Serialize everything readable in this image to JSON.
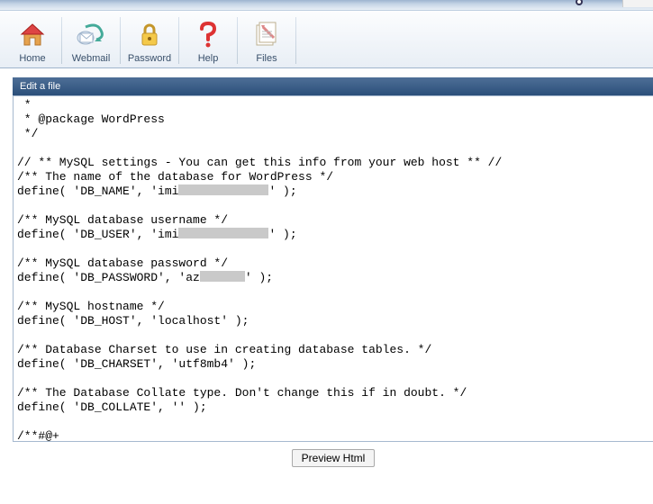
{
  "toolbar": {
    "items": [
      {
        "id": "home",
        "label": "Home",
        "icon": "home-icon"
      },
      {
        "id": "webmail",
        "label": "Webmail",
        "icon": "mail-icon"
      },
      {
        "id": "password",
        "label": "Password",
        "icon": "lock-icon"
      },
      {
        "id": "help",
        "label": "Help",
        "icon": "help-icon"
      },
      {
        "id": "files",
        "label": "Files",
        "icon": "files-icon"
      }
    ]
  },
  "panel": {
    "title": "Edit a file"
  },
  "editor": {
    "lines": [
      " *",
      " * @package WordPress",
      " */",
      "",
      "// ** MySQL settings - You can get this info from your web host ** //",
      "/** The name of the database for WordPress */",
      "define( 'DB_NAME', 'imi",
      "' );",
      "",
      "/** MySQL database username */",
      "define( 'DB_USER', 'imi",
      "' );",
      "",
      "/** MySQL database password */",
      "define( 'DB_PASSWORD', 'az",
      "' );",
      "",
      "/** MySQL hostname */",
      "define( 'DB_HOST', 'localhost' );",
      "",
      "/** Database Charset to use in creating database tables. */",
      "define( 'DB_CHARSET', 'utf8mb4' );",
      "",
      "/** The Database Collate type. Don't change this if in doubt. */",
      "define( 'DB_COLLATE', '' );",
      "",
      "/**#@+"
    ],
    "redacted_lines": {
      "6": "w1",
      "10": "w2",
      "14": "w3"
    }
  },
  "buttons": {
    "preview": "Preview Html"
  }
}
